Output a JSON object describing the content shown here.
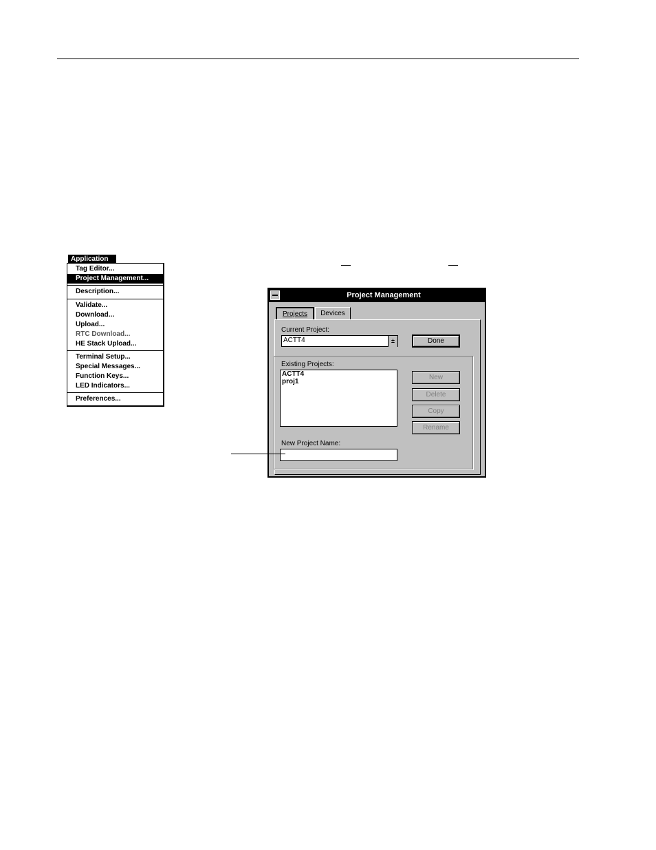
{
  "menu": {
    "title": "Application",
    "items": [
      {
        "label": "Tag Editor...",
        "selected": false
      },
      {
        "label": "Project Management...",
        "selected": true
      },
      {
        "label": "Description...",
        "selected": false
      },
      {
        "label": "Validate...",
        "selected": false
      },
      {
        "label": "Download...",
        "selected": false
      },
      {
        "label": "Upload...",
        "selected": false
      },
      {
        "label": "RTC Download...",
        "selected": false
      },
      {
        "label": "HE Stack Upload...",
        "selected": false
      },
      {
        "label": "Terminal Setup...",
        "selected": false
      },
      {
        "label": "Special Messages...",
        "selected": false
      },
      {
        "label": "Function Keys...",
        "selected": false
      },
      {
        "label": "LED Indicators...",
        "selected": false
      },
      {
        "label": "Preferences...",
        "selected": false
      }
    ]
  },
  "dialog": {
    "title": "Project Management",
    "tabs": [
      "Projects",
      "Devices"
    ],
    "current_project_label": "Current Project:",
    "current_project_value": "ACTT4",
    "combo_arrow": "±",
    "done_label": "Done",
    "existing_projects_label": "Existing Projects:",
    "existing_projects": [
      "ACTT4",
      "proj1"
    ],
    "buttons": {
      "new": "New",
      "delete": "Delete",
      "copy": "Copy",
      "rename": "Rename"
    },
    "new_project_name_label": "New Project Name:",
    "new_project_name_value": ""
  }
}
